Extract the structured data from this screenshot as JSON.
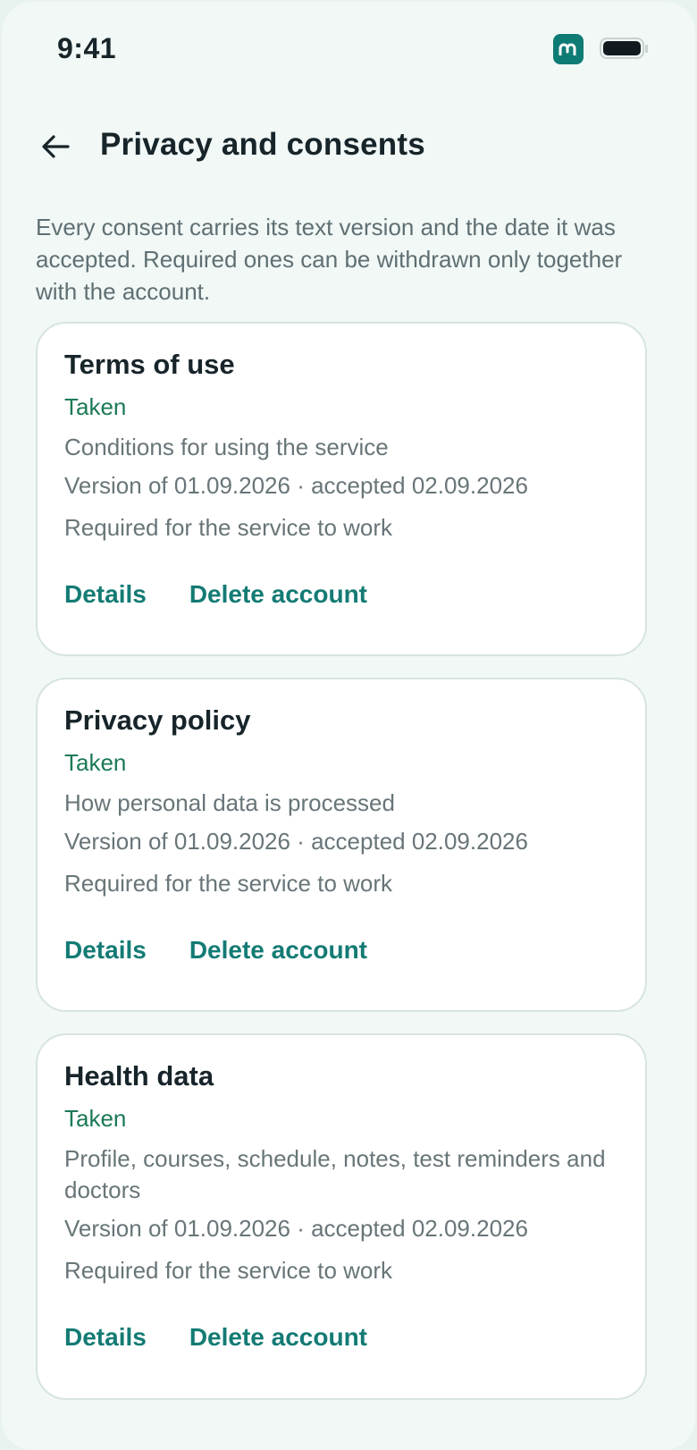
{
  "status_bar": {
    "time": "9:41"
  },
  "header": {
    "back_icon": "arrow-left-icon",
    "title": "Privacy and consents"
  },
  "intro": "Every consent carries its text version and the date it was accepted. Required ones can be withdrawn only together with the account.",
  "consents": [
    {
      "title": "Terms of use",
      "status": "Taken",
      "description": "Conditions for using the service",
      "version": "Version of 01.09.2026 · accepted 02.09.2026",
      "requirement": "Required for the service to work",
      "details_label": "Details",
      "delete_label": "Delete account"
    },
    {
      "title": "Privacy policy",
      "status": "Taken",
      "description": "How personal data is processed",
      "version": "Version of 01.09.2026 · accepted 02.09.2026",
      "requirement": "Required for the service to work",
      "details_label": "Details",
      "delete_label": "Delete account"
    },
    {
      "title": "Health data",
      "status": "Taken",
      "description": "Profile, courses, schedule, notes, test reminders and doctors",
      "version": "Version of 01.09.2026 · accepted 02.09.2026",
      "requirement": "Required for the service to work",
      "details_label": "Details",
      "delete_label": "Delete account"
    }
  ],
  "colors": {
    "accent": "#137b74",
    "status_taken": "#1b7a55",
    "background": "#f1f8f6"
  }
}
